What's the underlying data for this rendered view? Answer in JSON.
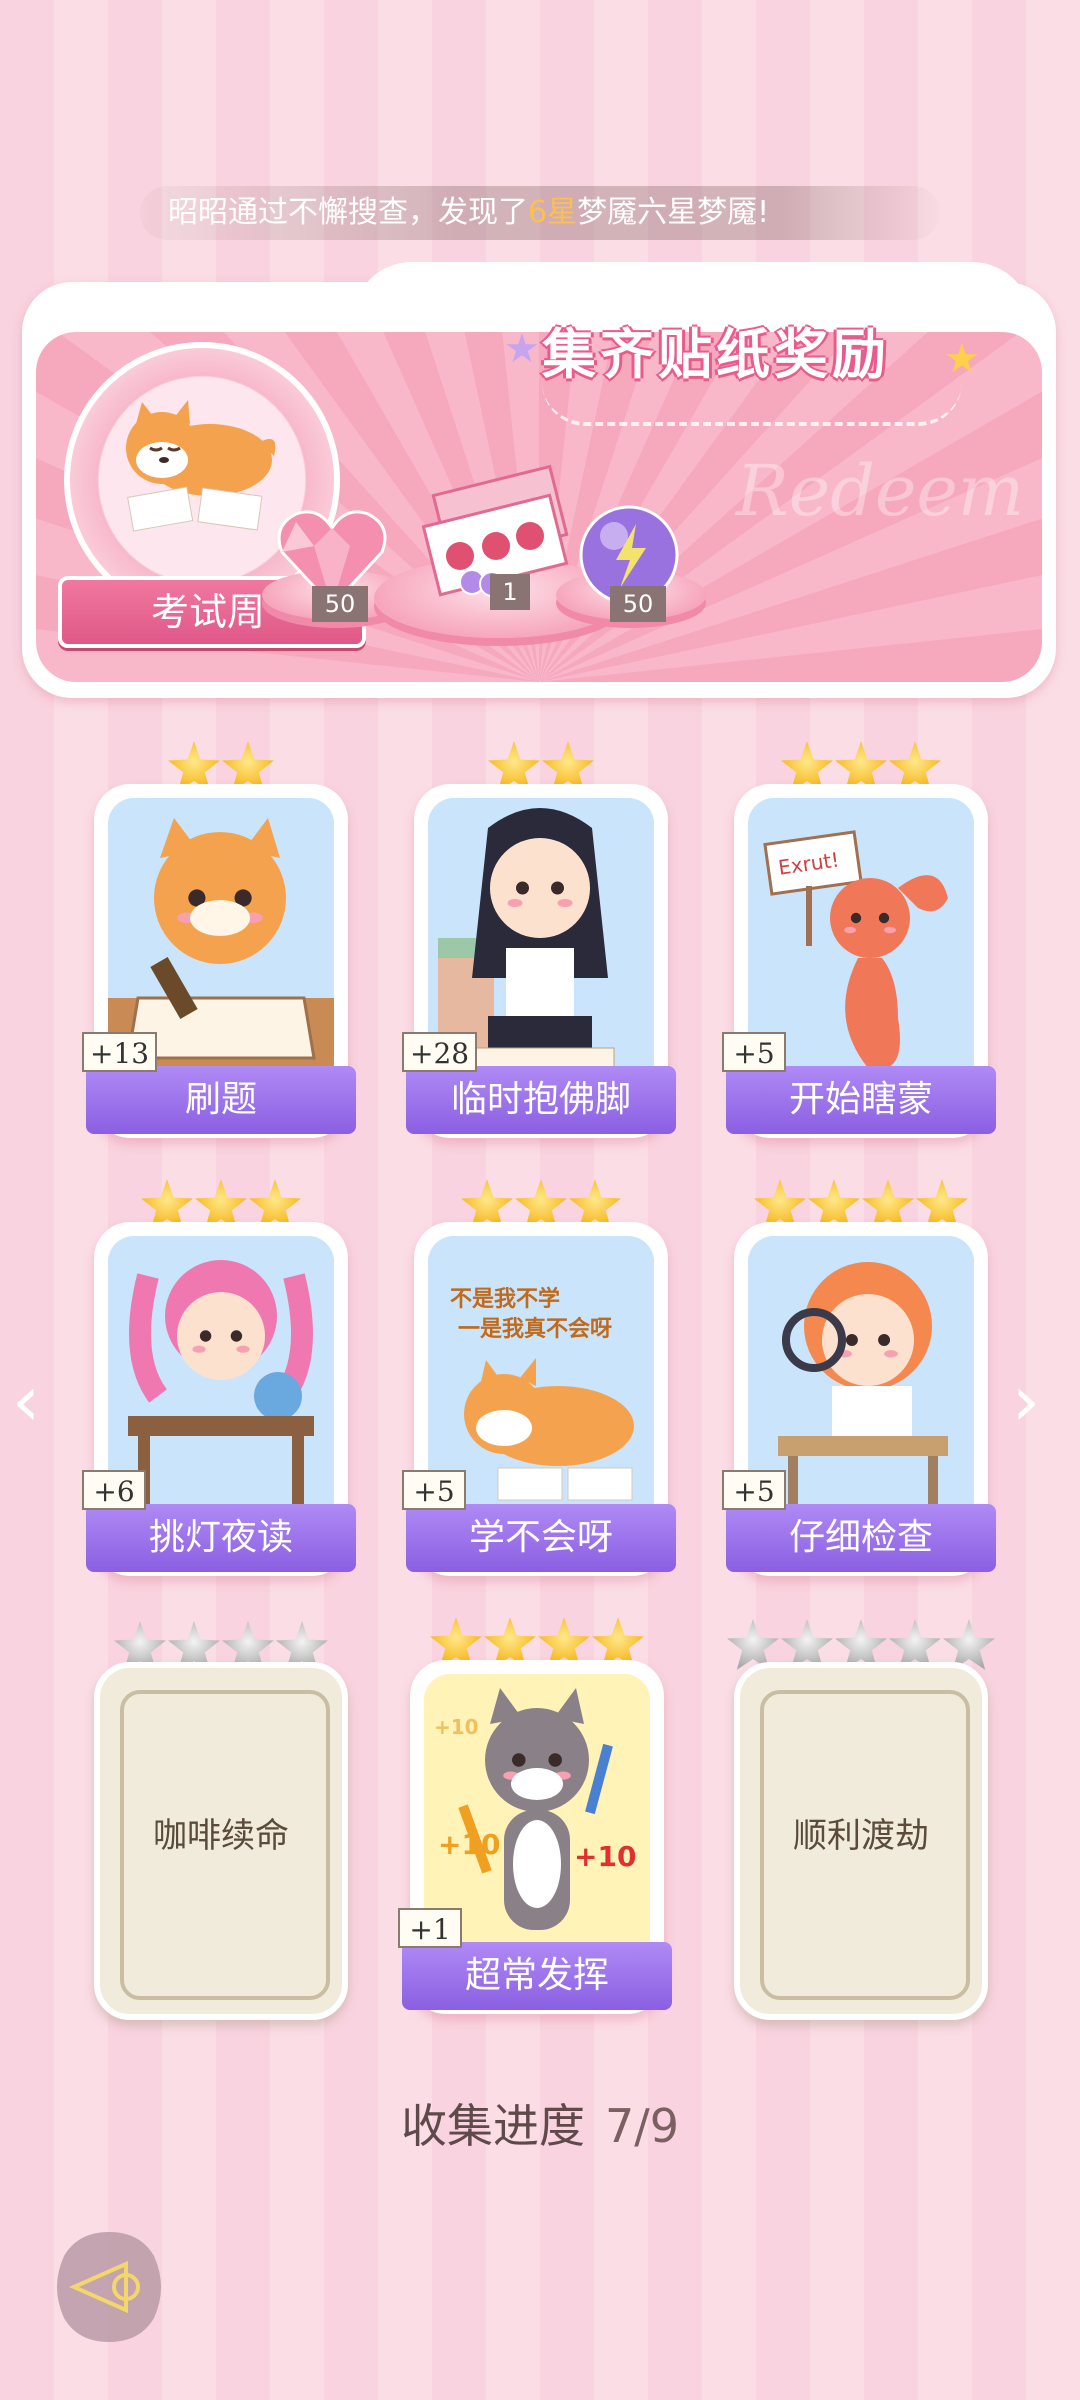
{
  "notice": {
    "prefix": "昭昭通过不懈搜查，发现了",
    "highlight": "6星",
    "suffix": "梦魇六星梦魇!"
  },
  "banner": {
    "title": "集齐贴纸奖励",
    "watermark": "Redeem",
    "theme_label": "考试周",
    "rewards": [
      {
        "name": "pink-heart-gem",
        "count": "50"
      },
      {
        "name": "gift-box",
        "count": "1"
      },
      {
        "name": "purple-energy-orb",
        "count": "50"
      }
    ]
  },
  "cards": [
    {
      "label": "刷题",
      "plus": "+13",
      "stars": 2,
      "art": "orange-cat-writing",
      "bg": "#c9e4fb"
    },
    {
      "label": "临时抱佛脚",
      "plus": "+28",
      "stars": 2,
      "art": "girl-reading",
      "bg": "#c9e4fb"
    },
    {
      "label": "开始瞎蒙",
      "plus": "+5",
      "stars": 3,
      "art": "shrimp-with-sign",
      "bg": "#c9e4fb"
    },
    {
      "label": "挑灯夜读",
      "plus": "+6",
      "stars": 3,
      "art": "pink-hair-girl-desk",
      "bg": "#c9e4fb"
    },
    {
      "label": "学不会呀",
      "plus": "+5",
      "stars": 3,
      "art": "shiba-lying",
      "bg": "#c9e4fb",
      "caption1": "不是我不学",
      "caption2": "一是我真不会呀"
    },
    {
      "label": "仔细检查",
      "plus": "+5",
      "stars": 4,
      "art": "girl-magnifier",
      "bg": "#c9e4fb"
    },
    {
      "label": "超常发挥",
      "plus": "+1",
      "stars": 4,
      "art": "grey-cat-pencils",
      "bg": "#fff3b8",
      "bonus": "+10",
      "bonus_faded": "+10"
    }
  ],
  "locked_cards": [
    {
      "label": "咖啡续命",
      "stars": 4
    },
    {
      "label": "顺利渡劫",
      "stars": 5
    }
  ],
  "progress": {
    "label": "收集进度",
    "value": "7/9"
  },
  "colors": {
    "accent_pink": "#e85b8a",
    "label_purple": "#8a5fe2",
    "gold_star": "#f5b315"
  }
}
